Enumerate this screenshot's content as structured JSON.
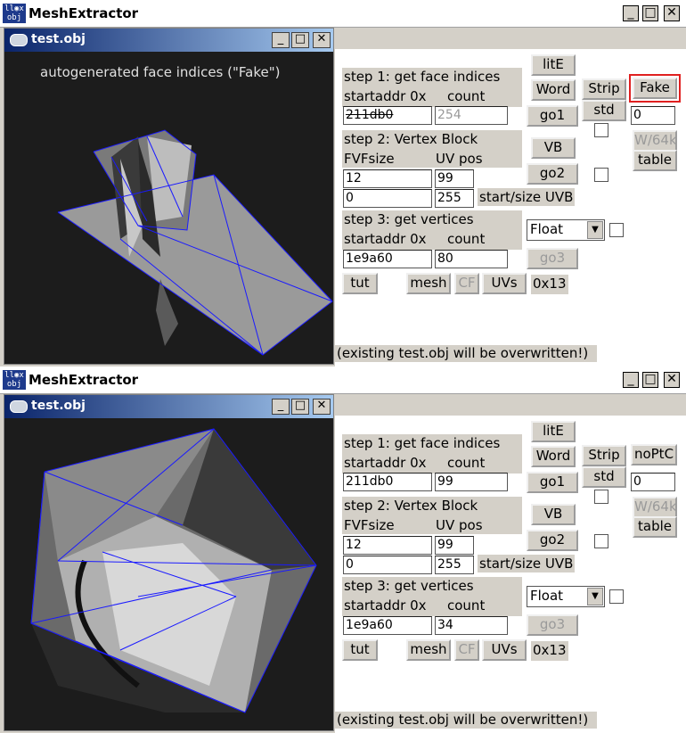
{
  "windows": [
    {
      "app_title": "MeshExtractor",
      "app_icon_text": "ll◉x\nobj",
      "child_title": "test.obj",
      "overlay_text": "autogenerated face indices (\"Fake\")",
      "step1": {
        "label": "step 1: get face indices",
        "startaddr_label": "startaddr 0x",
        "count_label": "count",
        "startaddr": "211db0",
        "count": "254"
      },
      "step2": {
        "label": "step 2: Vertex Block",
        "fvf_label": "FVFsize",
        "uvpos_label": "UV pos",
        "fvfsize": "12",
        "uvpos": "99",
        "start": "0",
        "size": "255",
        "startsize_label": "start/size UVB"
      },
      "step3": {
        "label": "step 3: get vertices",
        "startaddr_label": "startaddr 0x",
        "count_label": "count",
        "startaddr": "1e9a60",
        "count": "80"
      },
      "buttons": {
        "lite": "litE",
        "word": "Word",
        "go1": "go1",
        "strip": "Strip",
        "std": "std",
        "mode": "Fake",
        "vb": "VB",
        "go2": "go2",
        "w64k": "W/64k",
        "table": "table",
        "go3": "go3",
        "tut": "tut",
        "mesh": "mesh",
        "cf": "CF",
        "uvs": "UVs"
      },
      "mode_value": "0",
      "float_select": "Float",
      "hex_label": "0x13",
      "note": "(existing test.obj will be overwritten!)"
    },
    {
      "app_title": "MeshExtractor",
      "app_icon_text": "ll◉x\nobj",
      "child_title": "test.obj",
      "overlay_text": "",
      "step1": {
        "label": "step 1: get face indices",
        "startaddr_label": "startaddr 0x",
        "count_label": "count",
        "startaddr": "211db0",
        "count": "99"
      },
      "step2": {
        "label": "step 2: Vertex Block",
        "fvf_label": "FVFsize",
        "uvpos_label": "UV pos",
        "fvfsize": "12",
        "uvpos": "99",
        "start": "0",
        "size": "255",
        "startsize_label": "start/size UVB"
      },
      "step3": {
        "label": "step 3: get vertices",
        "startaddr_label": "startaddr 0x",
        "count_label": "count",
        "startaddr": "1e9a60",
        "count": "34"
      },
      "buttons": {
        "lite": "litE",
        "word": "Word",
        "go1": "go1",
        "strip": "Strip",
        "std": "std",
        "mode": "noPtC",
        "vb": "VB",
        "go2": "go2",
        "w64k": "W/64k",
        "table": "table",
        "go3": "go3",
        "tut": "tut",
        "mesh": "mesh",
        "cf": "CF",
        "uvs": "UVs"
      },
      "mode_value": "0",
      "float_select": "Float",
      "hex_label": "0x13",
      "note": "(existing test.obj will be overwritten!)"
    }
  ],
  "window_buttons": {
    "minimize": "_",
    "maximize": "□",
    "close": "✕"
  },
  "select_arrow": "▼",
  "colors": {
    "wireframe": "#1a1aff",
    "highlight": "#e02020"
  }
}
